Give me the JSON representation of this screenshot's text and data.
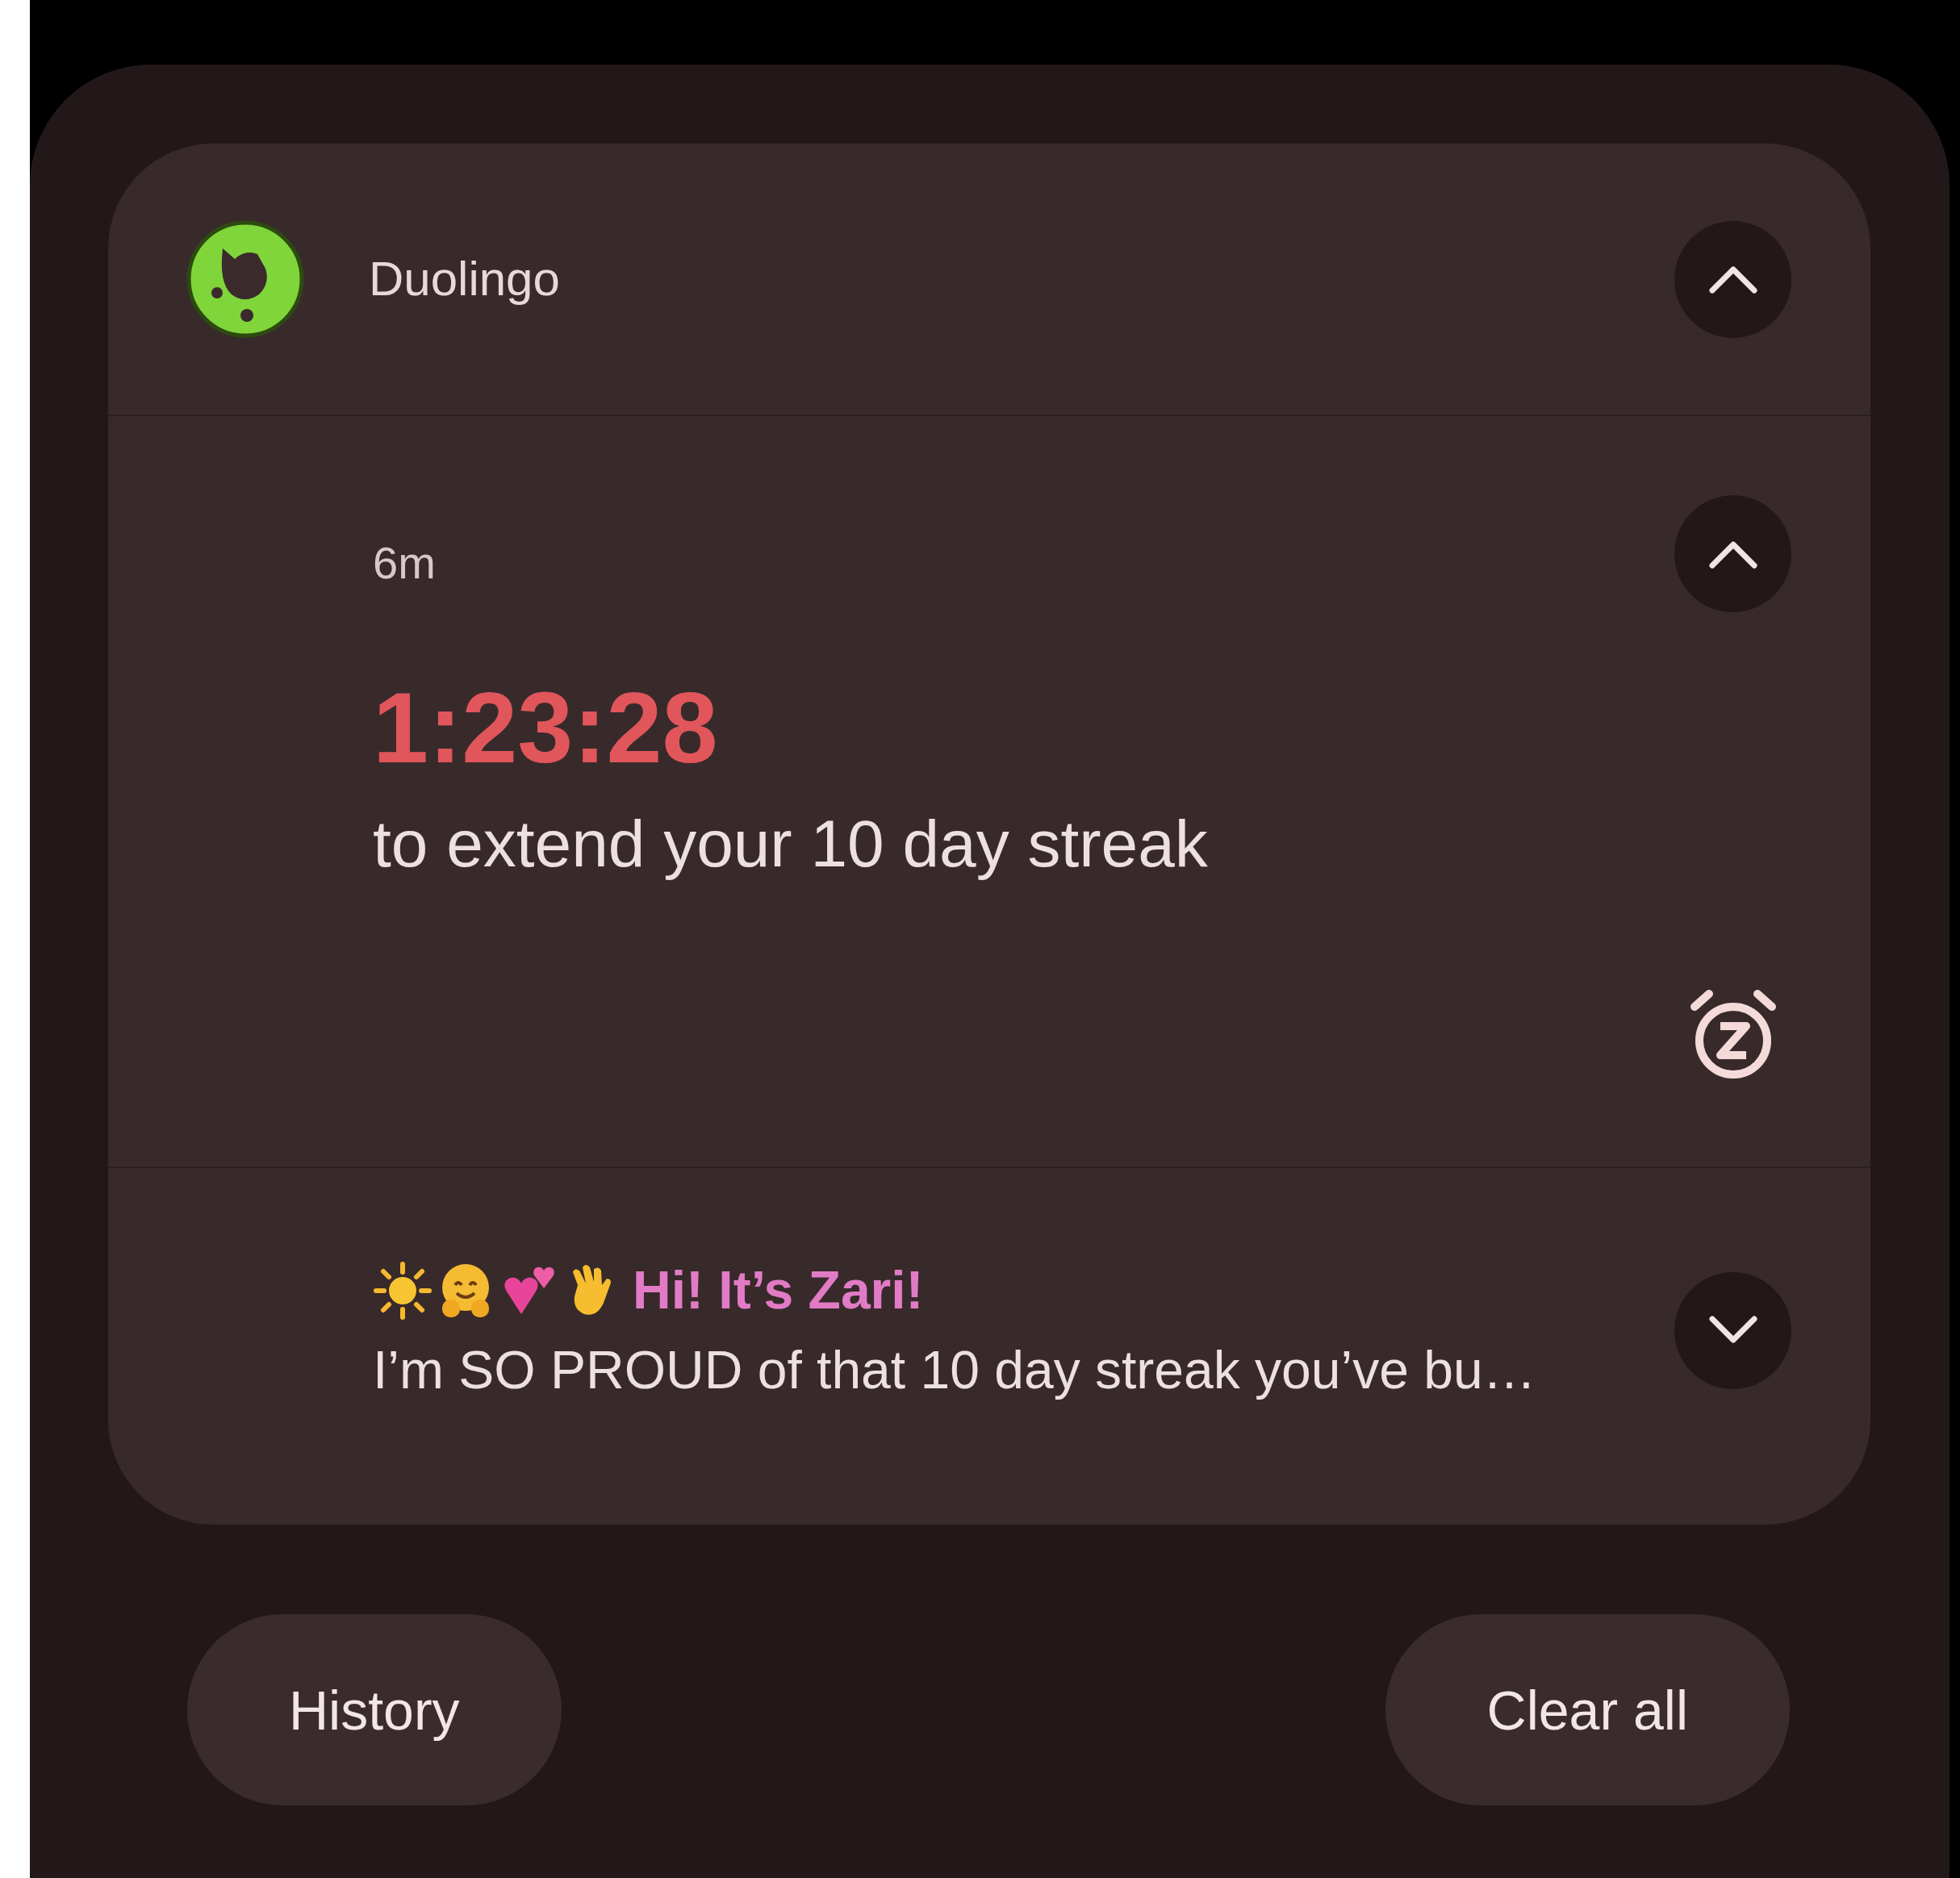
{
  "notification": {
    "app_name": "Duolingo",
    "expanded": true,
    "messages": [
      {
        "kind": "countdown",
        "time": "6m",
        "expanded": true,
        "title": "1:23:28",
        "body": "to extend your 10 day streak"
      },
      {
        "kind": "message",
        "expanded": false,
        "title": "Hi! It’s Zari!",
        "body": "I’m SO PROUD of that 10 day streak you’ve bu…"
      }
    ]
  },
  "buttons": [
    {
      "label": "History"
    },
    {
      "label": "Clear all"
    }
  ]
}
